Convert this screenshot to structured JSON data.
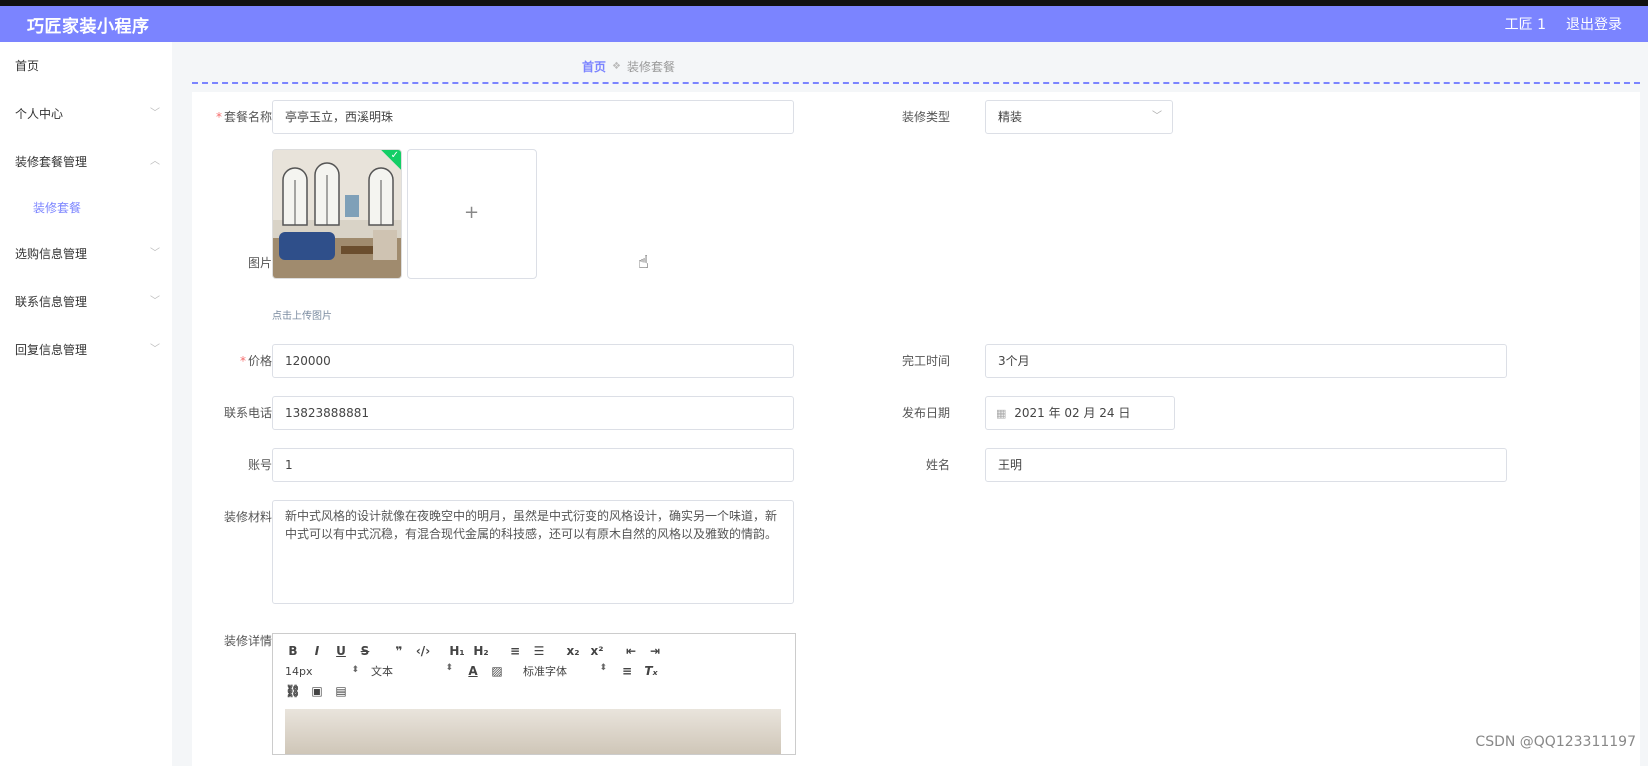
{
  "header": {
    "title": "巧匠家装小程序",
    "user": "工匠 1",
    "logout": "退出登录"
  },
  "sidebar": {
    "items": [
      {
        "label": "首页"
      },
      {
        "label": "个人中心"
      },
      {
        "label": "装修套餐管理"
      },
      {
        "label": "装修套餐"
      },
      {
        "label": "选购信息管理"
      },
      {
        "label": "联系信息管理"
      },
      {
        "label": "回复信息管理"
      }
    ]
  },
  "breadcrumb": {
    "home": "首页",
    "current": "装修套餐"
  },
  "form": {
    "package_name_label": "套餐名称",
    "package_name_value": "亭亭玉立，西溪明珠",
    "decoration_type_label": "装修类型",
    "decoration_type_value": "精装",
    "image_label": "图片",
    "upload_tip": "点击上传图片",
    "price_label": "价格",
    "price_value": "120000",
    "completion_time_label": "完工时间",
    "completion_time_value": "3个月",
    "phone_label": "联系电话",
    "phone_value": "13823888881",
    "publish_date_label": "发布日期",
    "publish_date_value": "2021 年 02 月 24 日",
    "account_label": "账号",
    "account_value": "1",
    "name_label": "姓名",
    "name_value": "王明",
    "materials_label": "装修材料",
    "materials_value": "新中式风格的设计就像在夜晚空中的明月，虽然是中式衍变的风格设计，确实另一个味道，新中式可以有中式沉稳，有混合现代金属的科技感，还可以有原木自然的风格以及雅致的情韵。",
    "details_label": "装修详情"
  },
  "editor": {
    "font_size": "14px",
    "format": "文本",
    "font_family": "标准字体"
  },
  "watermark": "CSDN @QQ123311197",
  "colors": {
    "accent": "#7b84ff",
    "success": "#13ce66",
    "required": "#f56c6c"
  }
}
